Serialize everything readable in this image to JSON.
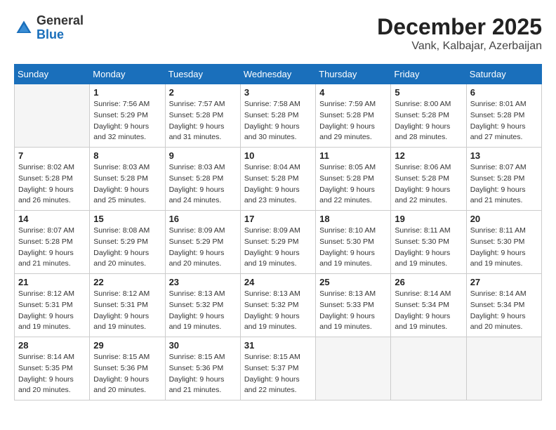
{
  "header": {
    "logo_general": "General",
    "logo_blue": "Blue",
    "month": "December 2025",
    "location": "Vank, Kalbajar, Azerbaijan"
  },
  "days_of_week": [
    "Sunday",
    "Monday",
    "Tuesday",
    "Wednesday",
    "Thursday",
    "Friday",
    "Saturday"
  ],
  "weeks": [
    [
      {
        "day": "",
        "empty": true
      },
      {
        "day": "1",
        "sunrise": "Sunrise: 7:56 AM",
        "sunset": "Sunset: 5:29 PM",
        "daylight": "Daylight: 9 hours and 32 minutes."
      },
      {
        "day": "2",
        "sunrise": "Sunrise: 7:57 AM",
        "sunset": "Sunset: 5:28 PM",
        "daylight": "Daylight: 9 hours and 31 minutes."
      },
      {
        "day": "3",
        "sunrise": "Sunrise: 7:58 AM",
        "sunset": "Sunset: 5:28 PM",
        "daylight": "Daylight: 9 hours and 30 minutes."
      },
      {
        "day": "4",
        "sunrise": "Sunrise: 7:59 AM",
        "sunset": "Sunset: 5:28 PM",
        "daylight": "Daylight: 9 hours and 29 minutes."
      },
      {
        "day": "5",
        "sunrise": "Sunrise: 8:00 AM",
        "sunset": "Sunset: 5:28 PM",
        "daylight": "Daylight: 9 hours and 28 minutes."
      },
      {
        "day": "6",
        "sunrise": "Sunrise: 8:01 AM",
        "sunset": "Sunset: 5:28 PM",
        "daylight": "Daylight: 9 hours and 27 minutes."
      }
    ],
    [
      {
        "day": "7",
        "sunrise": "Sunrise: 8:02 AM",
        "sunset": "Sunset: 5:28 PM",
        "daylight": "Daylight: 9 hours and 26 minutes."
      },
      {
        "day": "8",
        "sunrise": "Sunrise: 8:03 AM",
        "sunset": "Sunset: 5:28 PM",
        "daylight": "Daylight: 9 hours and 25 minutes."
      },
      {
        "day": "9",
        "sunrise": "Sunrise: 8:03 AM",
        "sunset": "Sunset: 5:28 PM",
        "daylight": "Daylight: 9 hours and 24 minutes."
      },
      {
        "day": "10",
        "sunrise": "Sunrise: 8:04 AM",
        "sunset": "Sunset: 5:28 PM",
        "daylight": "Daylight: 9 hours and 23 minutes."
      },
      {
        "day": "11",
        "sunrise": "Sunrise: 8:05 AM",
        "sunset": "Sunset: 5:28 PM",
        "daylight": "Daylight: 9 hours and 22 minutes."
      },
      {
        "day": "12",
        "sunrise": "Sunrise: 8:06 AM",
        "sunset": "Sunset: 5:28 PM",
        "daylight": "Daylight: 9 hours and 22 minutes."
      },
      {
        "day": "13",
        "sunrise": "Sunrise: 8:07 AM",
        "sunset": "Sunset: 5:28 PM",
        "daylight": "Daylight: 9 hours and 21 minutes."
      }
    ],
    [
      {
        "day": "14",
        "sunrise": "Sunrise: 8:07 AM",
        "sunset": "Sunset: 5:28 PM",
        "daylight": "Daylight: 9 hours and 21 minutes."
      },
      {
        "day": "15",
        "sunrise": "Sunrise: 8:08 AM",
        "sunset": "Sunset: 5:29 PM",
        "daylight": "Daylight: 9 hours and 20 minutes."
      },
      {
        "day": "16",
        "sunrise": "Sunrise: 8:09 AM",
        "sunset": "Sunset: 5:29 PM",
        "daylight": "Daylight: 9 hours and 20 minutes."
      },
      {
        "day": "17",
        "sunrise": "Sunrise: 8:09 AM",
        "sunset": "Sunset: 5:29 PM",
        "daylight": "Daylight: 9 hours and 19 minutes."
      },
      {
        "day": "18",
        "sunrise": "Sunrise: 8:10 AM",
        "sunset": "Sunset: 5:30 PM",
        "daylight": "Daylight: 9 hours and 19 minutes."
      },
      {
        "day": "19",
        "sunrise": "Sunrise: 8:11 AM",
        "sunset": "Sunset: 5:30 PM",
        "daylight": "Daylight: 9 hours and 19 minutes."
      },
      {
        "day": "20",
        "sunrise": "Sunrise: 8:11 AM",
        "sunset": "Sunset: 5:30 PM",
        "daylight": "Daylight: 9 hours and 19 minutes."
      }
    ],
    [
      {
        "day": "21",
        "sunrise": "Sunrise: 8:12 AM",
        "sunset": "Sunset: 5:31 PM",
        "daylight": "Daylight: 9 hours and 19 minutes."
      },
      {
        "day": "22",
        "sunrise": "Sunrise: 8:12 AM",
        "sunset": "Sunset: 5:31 PM",
        "daylight": "Daylight: 9 hours and 19 minutes."
      },
      {
        "day": "23",
        "sunrise": "Sunrise: 8:13 AM",
        "sunset": "Sunset: 5:32 PM",
        "daylight": "Daylight: 9 hours and 19 minutes."
      },
      {
        "day": "24",
        "sunrise": "Sunrise: 8:13 AM",
        "sunset": "Sunset: 5:32 PM",
        "daylight": "Daylight: 9 hours and 19 minutes."
      },
      {
        "day": "25",
        "sunrise": "Sunrise: 8:13 AM",
        "sunset": "Sunset: 5:33 PM",
        "daylight": "Daylight: 9 hours and 19 minutes."
      },
      {
        "day": "26",
        "sunrise": "Sunrise: 8:14 AM",
        "sunset": "Sunset: 5:34 PM",
        "daylight": "Daylight: 9 hours and 19 minutes."
      },
      {
        "day": "27",
        "sunrise": "Sunrise: 8:14 AM",
        "sunset": "Sunset: 5:34 PM",
        "daylight": "Daylight: 9 hours and 20 minutes."
      }
    ],
    [
      {
        "day": "28",
        "sunrise": "Sunrise: 8:14 AM",
        "sunset": "Sunset: 5:35 PM",
        "daylight": "Daylight: 9 hours and 20 minutes."
      },
      {
        "day": "29",
        "sunrise": "Sunrise: 8:15 AM",
        "sunset": "Sunset: 5:36 PM",
        "daylight": "Daylight: 9 hours and 20 minutes."
      },
      {
        "day": "30",
        "sunrise": "Sunrise: 8:15 AM",
        "sunset": "Sunset: 5:36 PM",
        "daylight": "Daylight: 9 hours and 21 minutes."
      },
      {
        "day": "31",
        "sunrise": "Sunrise: 8:15 AM",
        "sunset": "Sunset: 5:37 PM",
        "daylight": "Daylight: 9 hours and 22 minutes."
      },
      {
        "day": "",
        "empty": true
      },
      {
        "day": "",
        "empty": true
      },
      {
        "day": "",
        "empty": true
      }
    ]
  ]
}
